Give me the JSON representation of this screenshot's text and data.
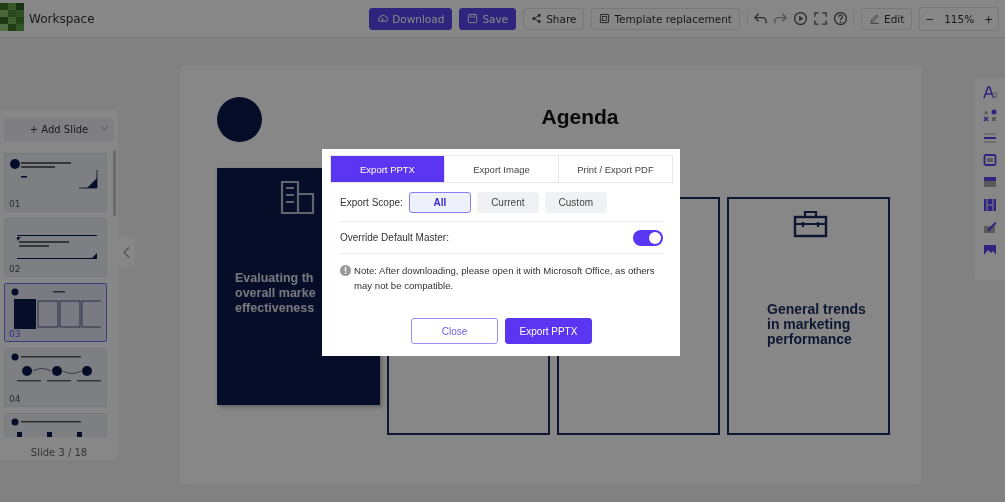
{
  "topbar": {
    "title": "Workspace",
    "buttons": [
      {
        "kind": "primary",
        "label": "Download"
      },
      {
        "kind": "primary",
        "label": "Save"
      },
      {
        "kind": "plain",
        "label": "Share"
      },
      {
        "kind": "plain",
        "label": "Template replacement"
      }
    ],
    "edit": "Edit",
    "zoom": {
      "minus": "−",
      "value": "115%",
      "plus": "+"
    }
  },
  "sidebar": {
    "add_slide": "+ Add Slide",
    "slides": [
      {
        "number": "01",
        "selected": false
      },
      {
        "number": "02",
        "selected": false
      },
      {
        "number": "03",
        "selected": true
      },
      {
        "number": "04",
        "selected": false
      },
      {
        "selected": false
      }
    ],
    "counter": "Slide 3 / 18"
  },
  "slide": {
    "title": "Agenda",
    "card_text": [
      "Evaluating th",
      "overall marke",
      "effectiveness"
    ],
    "card4_text": "General trends in marketing performance"
  },
  "dialog": {
    "tabs": [
      {
        "label": "Export PPTX",
        "selected": true
      },
      {
        "label": "Export Image",
        "selected": false
      },
      {
        "label": "Print / Export PDF",
        "selected": false
      }
    ],
    "scope_label": "Export Scope:",
    "scope_options": [
      {
        "label": "All",
        "selected": true
      },
      {
        "label": "Current",
        "selected": false
      },
      {
        "label": "Custom",
        "selected": false
      }
    ],
    "override_label": "Override Default Master:",
    "override": {
      "on": true
    },
    "note": "Note: After downloading, please open it with Microsoft Office, as others may not be compatible.",
    "buttons": [
      {
        "kind": "secondary",
        "label": "Close"
      },
      {
        "kind": "primary",
        "label": "Export PPTX"
      }
    ]
  }
}
